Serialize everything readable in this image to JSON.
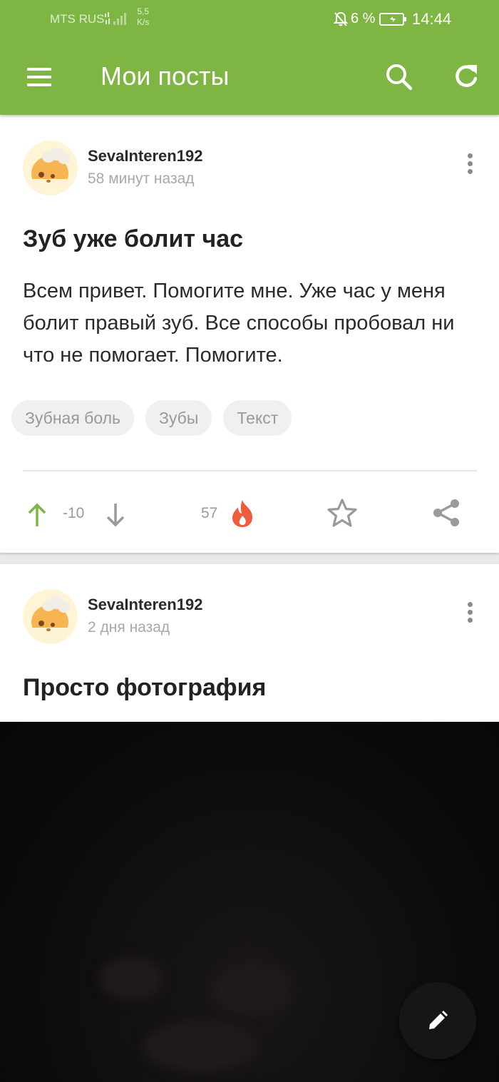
{
  "status_bar": {
    "carrier": "MTS RUS",
    "speed_value": "5,5",
    "speed_unit": "K/s",
    "battery": "6 %",
    "time": "14:44"
  },
  "header": {
    "title": "Мои посты"
  },
  "posts": [
    {
      "author": "SevaInteren192",
      "time": "58 минут назад",
      "title": "Зуб уже болит час",
      "body": "Всем привет. Помогите мне. Уже час у меня болит правый зуб. Все способы пробовал ни что не помогает. Помогите.",
      "tags": [
        "Зубная боль",
        "Зубы",
        "Текст"
      ],
      "rating": "-10",
      "comments": "57"
    },
    {
      "author": "SevaInteren192",
      "time": "2 дня назад",
      "title": "Просто фотография"
    }
  ],
  "colors": {
    "appbar": "#7eb543",
    "upvote": "#7eb543",
    "fire": "#ee5b3d",
    "muted": "#9a9a9a"
  },
  "icons": [
    "menu-icon",
    "search-icon",
    "refresh-icon",
    "more-vert-icon",
    "arrow-up-icon",
    "arrow-down-icon",
    "fire-icon",
    "star-icon",
    "share-icon",
    "pencil-icon"
  ]
}
